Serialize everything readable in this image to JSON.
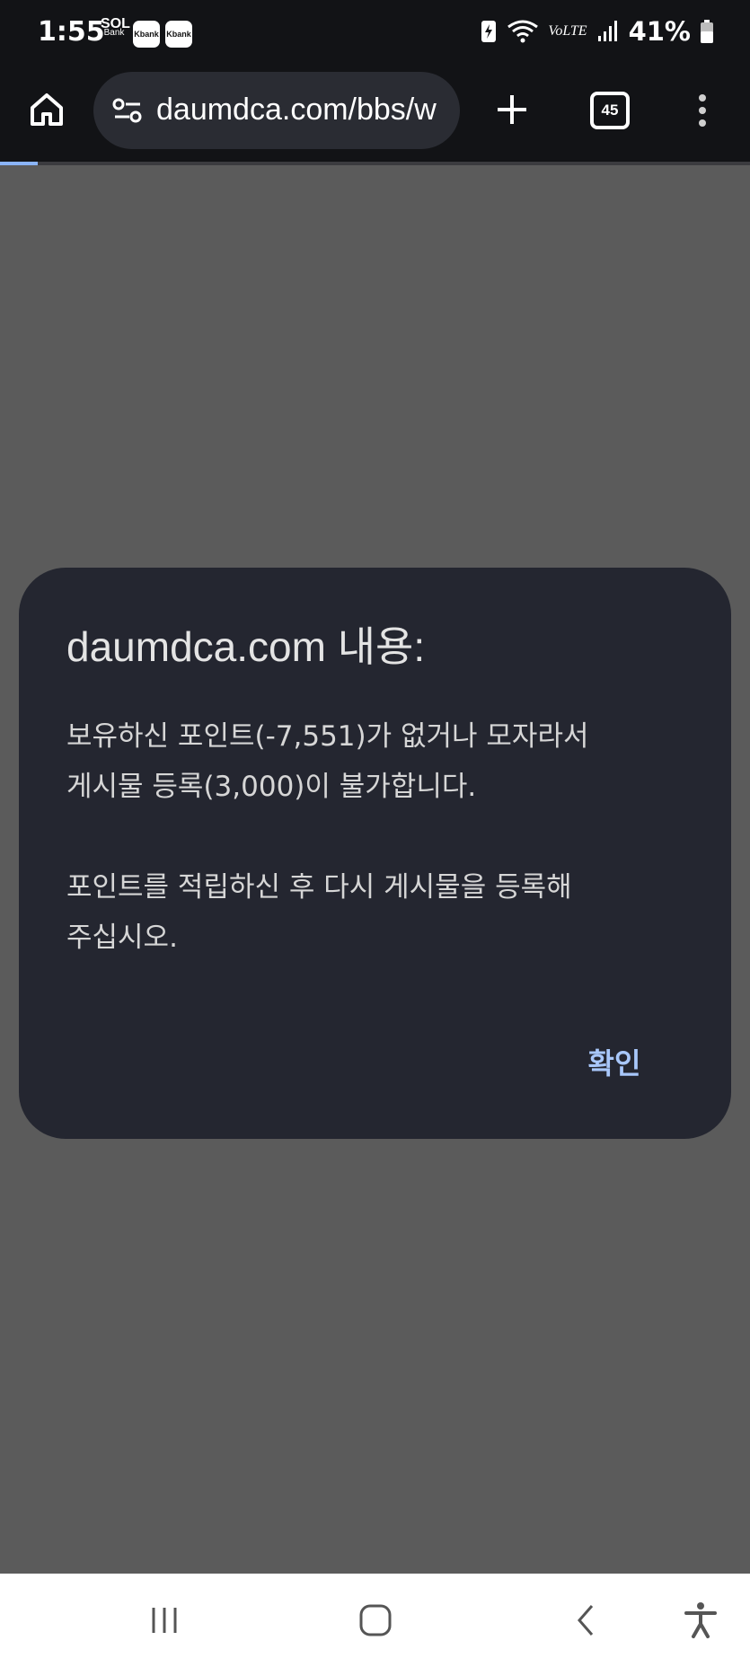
{
  "status_bar": {
    "time": "1:55",
    "app_badges": [
      "SOL Bank",
      "Kbank",
      "Kbank"
    ],
    "sol_label_top": "SOL",
    "sol_label_bottom": "Bank",
    "kbank_label": "Kbank",
    "network": "VoLTE",
    "battery_percent": "41%",
    "icons": [
      "battery-saver-icon",
      "wifi-icon",
      "signal-icon",
      "battery-icon"
    ]
  },
  "browser": {
    "url": "daumdca.com/bbs/w",
    "tab_count": "45",
    "page_load_progress": 0.05,
    "icons": [
      "home-icon",
      "site-settings-icon",
      "new-tab-icon",
      "tab-switcher-icon",
      "more-menu-icon"
    ]
  },
  "dialog": {
    "title": "daumdca.com 내용:",
    "message": "보유하신 포인트(-7,551)가 없거나 모자라서\n게시물 등록(3,000)이 불가합니다.\n\n포인트를 적립하신 후 다시 게시물을 등록해\n주십시오.",
    "ok_label": "확인"
  },
  "nav_bar": {
    "icons": [
      "recent-apps-icon",
      "home-button-icon",
      "back-icon",
      "accessibility-icon"
    ]
  },
  "colors": {
    "chrome_bg": "#121316",
    "omnibox_bg": "#2a2c33",
    "dimmed_page": "#5b5b5b",
    "dialog_bg": "#242630",
    "accent": "#a8c7fa"
  }
}
